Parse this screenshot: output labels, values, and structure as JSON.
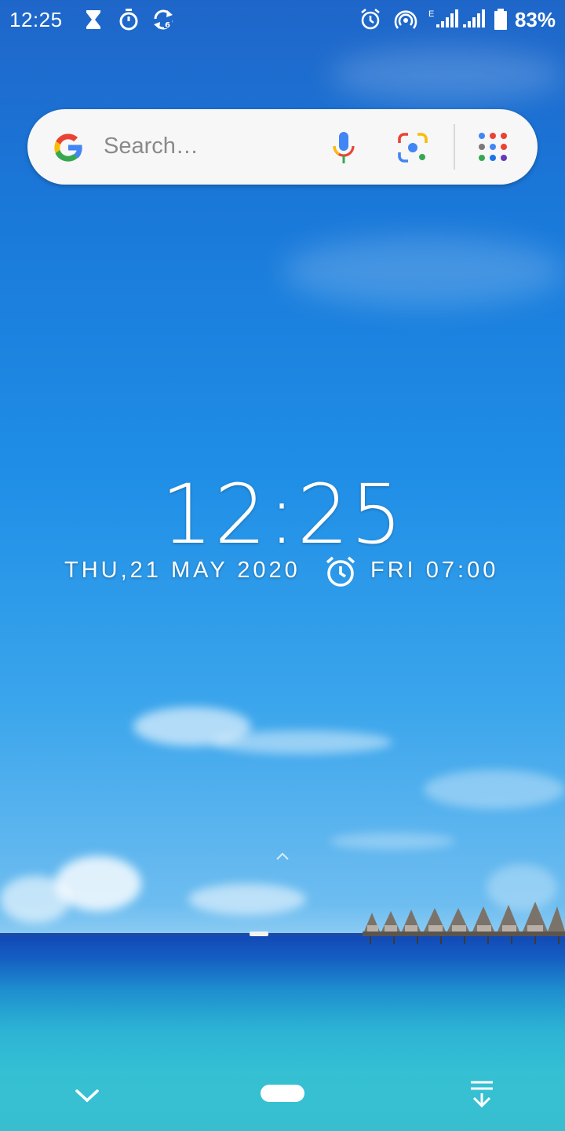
{
  "status_bar": {
    "time": "12:25",
    "battery_percent": "83%",
    "network_label": "E",
    "icons": [
      "hourglass-icon",
      "stopwatch-icon",
      "sync-icon",
      "alarm-icon",
      "hotspot-icon",
      "signal-icon",
      "signal-icon-2",
      "battery-icon"
    ]
  },
  "search": {
    "placeholder": "Search…",
    "icons": [
      "google-logo-icon",
      "microphone-icon",
      "lens-icon",
      "apps-grid-icon"
    ]
  },
  "clock": {
    "time": "12:25",
    "date": "THU,21 MAY 2020",
    "next_alarm": "FRI 07:00"
  },
  "navigation": {
    "icons": [
      "chevron-down-icon",
      "home-pill-icon",
      "notifications-pull-icon",
      "swipe-up-chevron-icon"
    ]
  },
  "colors": {
    "google_blue": "#4285F4",
    "google_red": "#EA4335",
    "google_yellow": "#FBBC05",
    "google_green": "#34A853"
  }
}
